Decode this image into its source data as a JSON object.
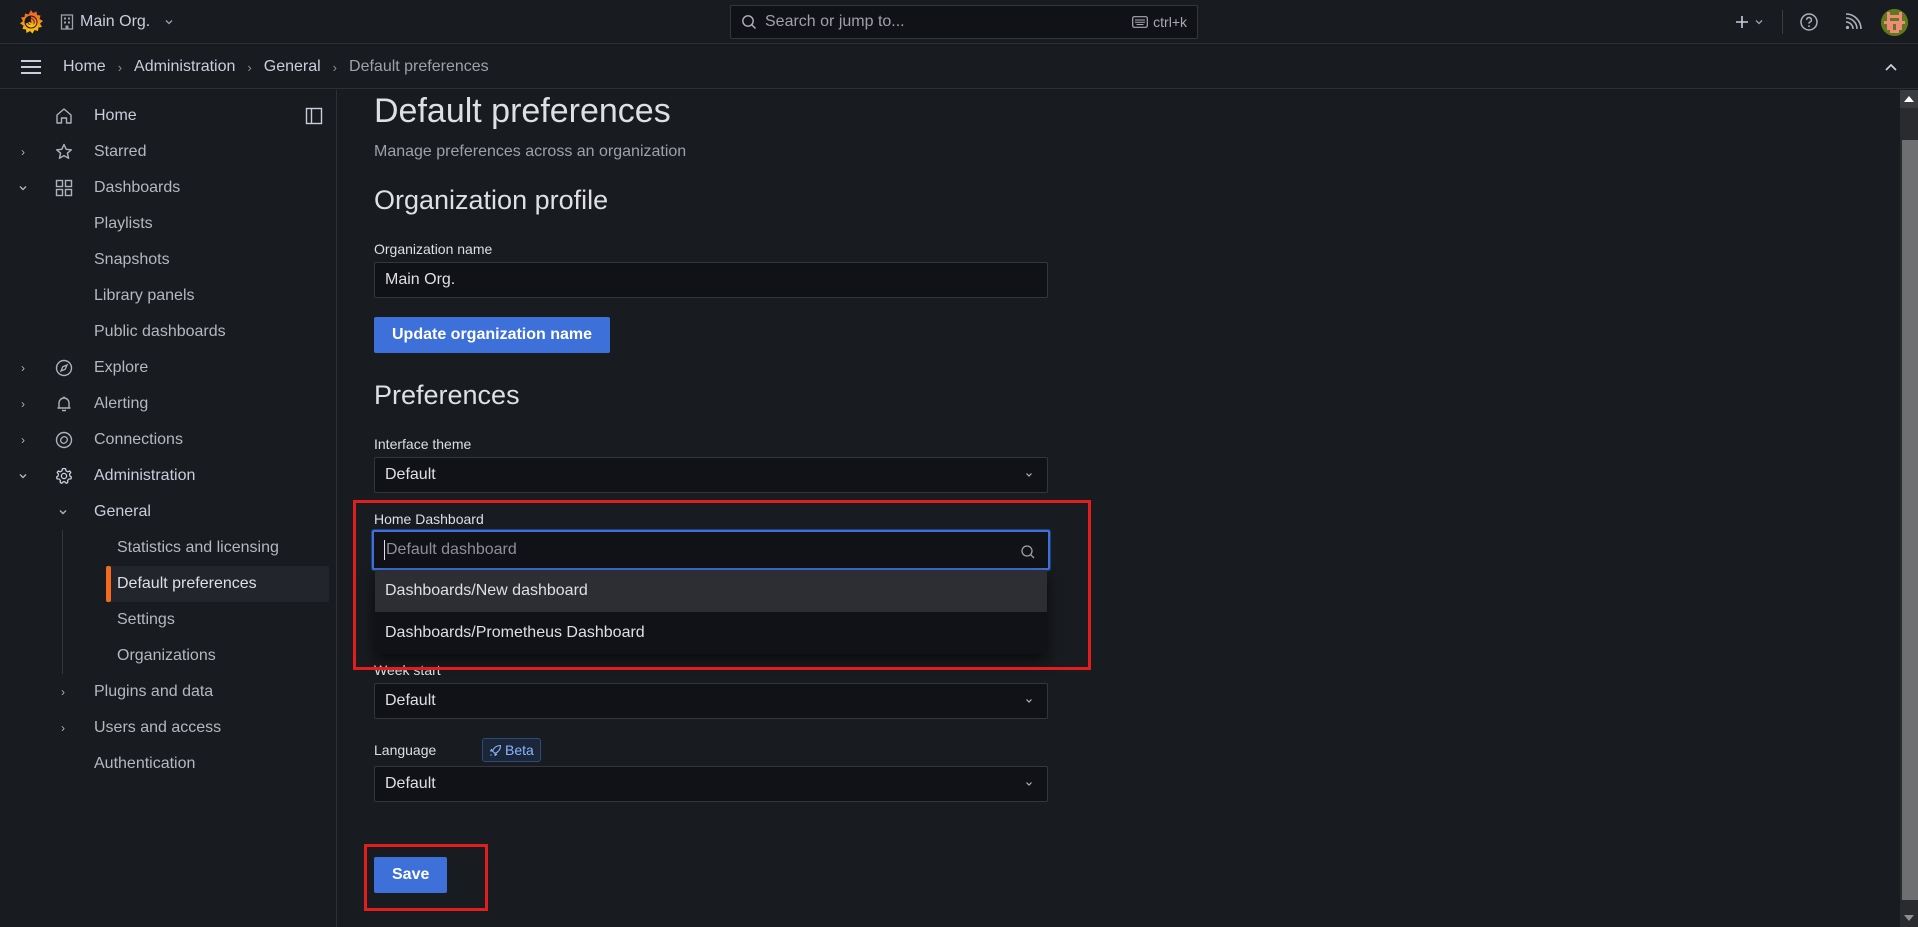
{
  "topbar": {
    "org_name": "Main Org.",
    "search_placeholder": "Search or jump to...",
    "search_shortcut": "ctrl+k"
  },
  "breadcrumb": [
    {
      "label": "Home"
    },
    {
      "label": "Administration"
    },
    {
      "label": "General"
    },
    {
      "label": "Default preferences"
    }
  ],
  "sidebar": {
    "items": [
      {
        "label": "Home",
        "icon": "home-icon"
      },
      {
        "label": "Starred",
        "icon": "star-icon",
        "expander": "collapsed"
      },
      {
        "label": "Dashboards",
        "icon": "apps-icon",
        "expander": "expanded"
      },
      {
        "label": "Playlists"
      },
      {
        "label": "Snapshots"
      },
      {
        "label": "Library panels"
      },
      {
        "label": "Public dashboards"
      },
      {
        "label": "Explore",
        "icon": "compass-icon",
        "expander": "collapsed"
      },
      {
        "label": "Alerting",
        "icon": "bell-icon",
        "expander": "collapsed"
      },
      {
        "label": "Connections",
        "icon": "connections-icon",
        "expander": "collapsed"
      },
      {
        "label": "Administration",
        "icon": "cog-icon",
        "expander": "expanded"
      },
      {
        "label": "General",
        "expander": "expanded"
      },
      {
        "label": "Statistics and licensing"
      },
      {
        "label": "Default preferences",
        "active": true
      },
      {
        "label": "Settings"
      },
      {
        "label": "Organizations"
      },
      {
        "label": "Plugins and data",
        "expander": "collapsed"
      },
      {
        "label": "Users and access",
        "expander": "collapsed"
      },
      {
        "label": "Authentication"
      }
    ]
  },
  "page": {
    "title": "Default preferences",
    "subtitle": "Manage preferences across an organization",
    "org_profile": {
      "heading": "Organization profile",
      "name_label": "Organization name",
      "name_value": "Main Org.",
      "update_button": "Update organization name"
    },
    "preferences": {
      "heading": "Preferences",
      "theme_label": "Interface theme",
      "theme_value": "Default",
      "home_dashboard_label": "Home Dashboard",
      "home_dashboard_placeholder": "Default dashboard",
      "home_dashboard_options": [
        "Dashboards/New dashboard",
        "Dashboards/Prometheus Dashboard"
      ],
      "week_start_label": "Week start",
      "week_start_value": "Default",
      "language_label": "Language",
      "language_badge": "Beta",
      "language_value": "Default",
      "save_button": "Save"
    }
  },
  "colors": {
    "primary": "#3d71d9",
    "active_indicator": "#f66a1f",
    "highlight_box": "#e01e1e"
  }
}
